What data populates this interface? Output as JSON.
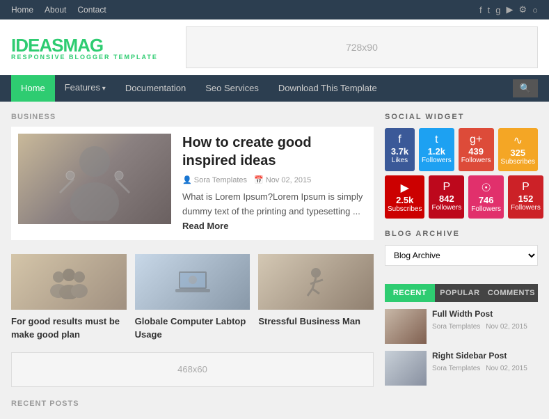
{
  "topNav": {
    "links": [
      "Home",
      "About",
      "Contact"
    ],
    "icons": [
      "facebook",
      "twitter",
      "google-plus",
      "youtube",
      "settings",
      "circle"
    ]
  },
  "header": {
    "logoMain": "IDEAS",
    "logoAccent": "MAG",
    "logoSub": "RESPONSIVE BLOGGER TEMPLATE",
    "adText": "728x90"
  },
  "mainNav": {
    "items": [
      {
        "label": "Home",
        "active": true
      },
      {
        "label": "Features",
        "hasDropdown": true
      },
      {
        "label": "Documentation"
      },
      {
        "label": "Seo Services"
      },
      {
        "label": "Download This Template"
      }
    ]
  },
  "business": {
    "sectionLabel": "BUSINESS",
    "featuredPost": {
      "title": "How to create good inspired ideas",
      "author": "Sora Templates",
      "date": "Nov 02, 2015",
      "excerpt": "What is Lorem Ipsum?Lorem Ipsum is simply dummy text of the printing and typesetting ...",
      "readMore": "Read More"
    },
    "smallPosts": [
      {
        "title": "For good results must be make good plan"
      },
      {
        "title": "Globale Computer Labtop Usage"
      },
      {
        "title": "Stressful Business Man"
      }
    ]
  },
  "adBanner2": "468x60",
  "recentPostsLabel": "RECENT POSTS",
  "sidebar": {
    "socialWidget": {
      "title": "SOCIAL WIDGET",
      "buttons": [
        {
          "platform": "Facebook",
          "icon": "f",
          "count": "3.7k",
          "label": "Likes",
          "color": "fb"
        },
        {
          "platform": "Twitter",
          "icon": "t",
          "count": "1.2k",
          "label": "Followers",
          "color": "tw"
        },
        {
          "platform": "Google+",
          "icon": "g+",
          "count": "439",
          "label": "Followers",
          "color": "gp"
        },
        {
          "platform": "RSS",
          "icon": "rss",
          "count": "325",
          "label": "Subscribes",
          "color": "rs"
        },
        {
          "platform": "YouTube",
          "icon": "▶",
          "count": "2.5k",
          "label": "Subscribes",
          "color": "yt"
        },
        {
          "platform": "Pinterest",
          "icon": "P",
          "count": "842",
          "label": "Followers",
          "color": "pi"
        },
        {
          "platform": "Instagram",
          "icon": "in",
          "count": "746",
          "label": "Followers",
          "color": "ig"
        },
        {
          "platform": "Pinterest2",
          "icon": "P",
          "count": "152",
          "label": "Followers",
          "color": "pin"
        }
      ]
    },
    "blogArchive": {
      "title": "BLOG ARCHIVE",
      "placeholder": "Blog Archive"
    },
    "tabs": [
      {
        "label": "RECENT",
        "active": true
      },
      {
        "label": "POPULAR",
        "active": false
      },
      {
        "label": "COMMENTS",
        "active": false
      }
    ],
    "recentItems": [
      {
        "title": "Full Width Post",
        "author": "Sora Templates",
        "date": "Nov 02, 2015"
      },
      {
        "title": "Right Sidebar Post",
        "author": "Sora Templates",
        "date": "Nov 02, 2015"
      }
    ]
  }
}
